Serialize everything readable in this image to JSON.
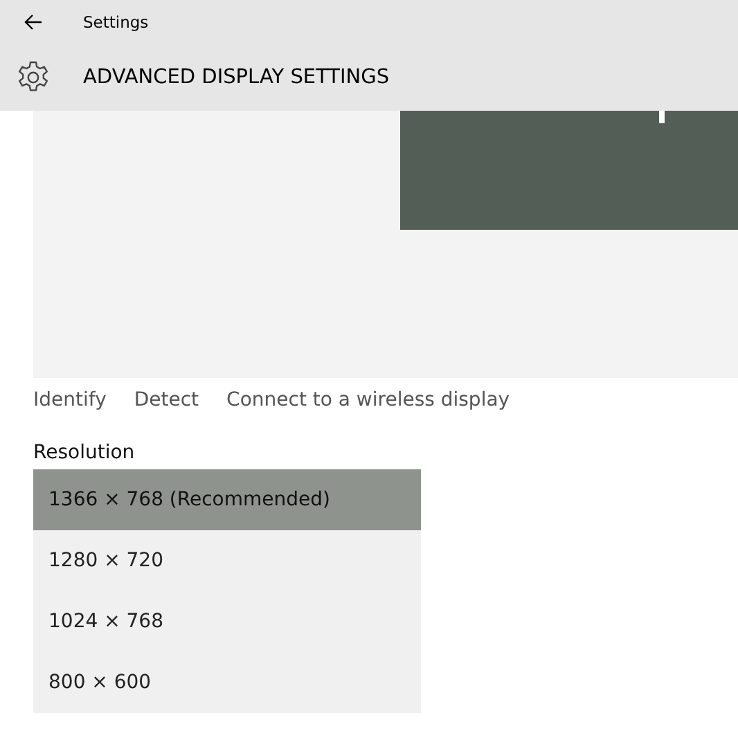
{
  "window": {
    "title": "Settings"
  },
  "header": {
    "title": "ADVANCED DISPLAY SETTINGS"
  },
  "links": [
    "Identify",
    "Detect",
    "Connect to a wireless display"
  ],
  "resolution": {
    "label": "Resolution",
    "options": [
      {
        "label": "1366 × 768 (Recommended)",
        "selected": true
      },
      {
        "label": "1280 × 720",
        "selected": false
      },
      {
        "label": "1024 × 768",
        "selected": false
      },
      {
        "label": "800 × 600",
        "selected": false
      }
    ]
  }
}
